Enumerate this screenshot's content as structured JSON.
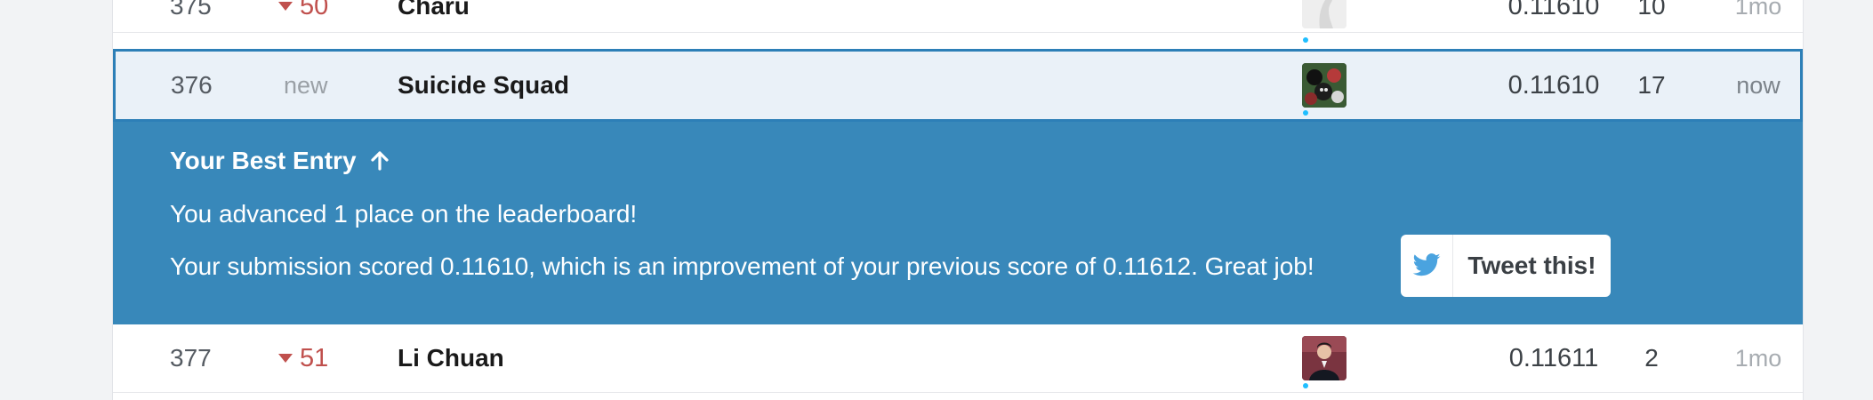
{
  "rows": [
    {
      "rank": "375",
      "change": "50",
      "change_dir": "down",
      "team": "Charu",
      "score": "0.11610",
      "entries": "10",
      "last": "1mo",
      "avatar": "bird-avatar"
    },
    {
      "rank": "376",
      "change": "new",
      "change_dir": "new",
      "team": "Suicide Squad",
      "score": "0.11610",
      "entries": "17",
      "last": "now",
      "avatar": "team-avatar"
    },
    {
      "rank": "377",
      "change": "51",
      "change_dir": "down",
      "team": "Li Chuan",
      "score": "0.11611",
      "entries": "2",
      "last": "1mo",
      "avatar": "person-avatar"
    }
  ],
  "banner": {
    "title": "Your Best Entry",
    "title_icon": "arrow-up-icon",
    "line1": "You advanced 1 place on the leaderboard!",
    "line2": "Your submission scored 0.11610, which is an improvement of your previous score of 0.11612. Great job!",
    "tweet_label": "Tweet this!",
    "tweet_icon": "twitter-bird-icon"
  },
  "colors": {
    "highlight_border": "#2d7fb7",
    "highlight_bg": "#eaf1f8",
    "banner_bg": "#3888ba",
    "rank_down": "#c0504d",
    "twitter_blue": "#4aa3df",
    "online_dot": "#20beff"
  }
}
